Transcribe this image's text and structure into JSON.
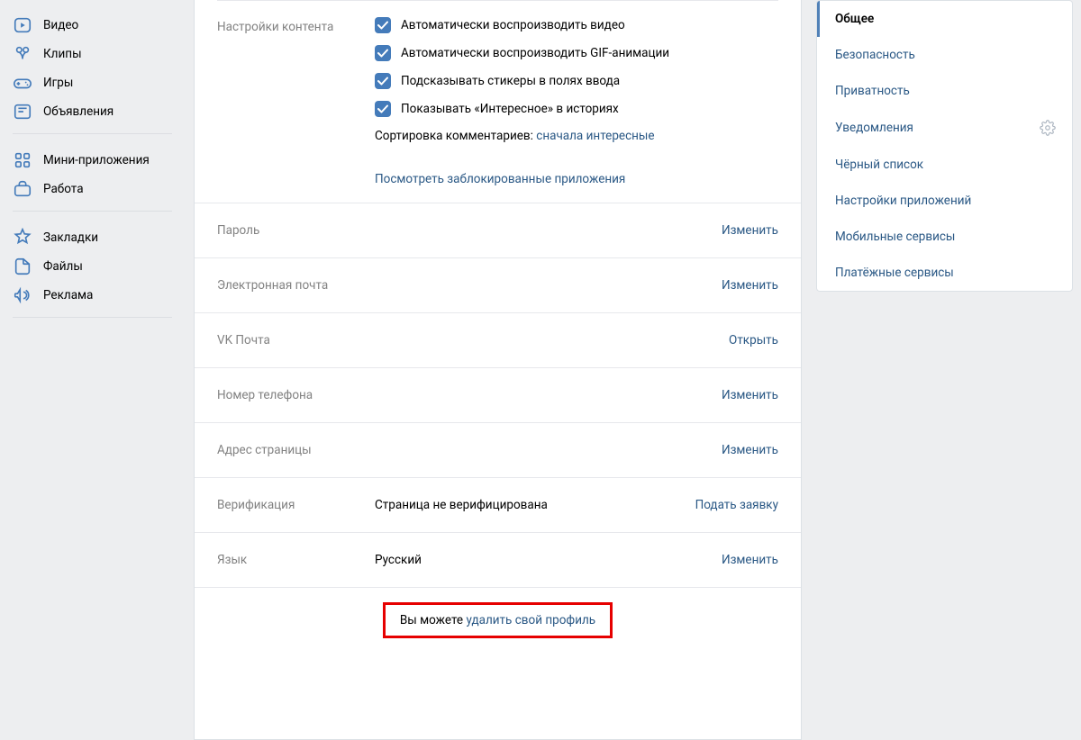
{
  "leftNav": {
    "group1": [
      {
        "icon": "video",
        "label": "Видео"
      },
      {
        "icon": "clips",
        "label": "Клипы"
      },
      {
        "icon": "games",
        "label": "Игры"
      },
      {
        "icon": "ads",
        "label": "Объявления"
      }
    ],
    "group2": [
      {
        "icon": "miniapps",
        "label": "Мини-приложения"
      },
      {
        "icon": "work",
        "label": "Работа"
      }
    ],
    "group3": [
      {
        "icon": "bookmarks",
        "label": "Закладки"
      },
      {
        "icon": "files",
        "label": "Файлы"
      },
      {
        "icon": "promo",
        "label": "Реклама"
      }
    ]
  },
  "content": {
    "sectionLabel": "Настройки контента",
    "checks": [
      "Автоматически воспроизводить видео",
      "Автоматически воспроизводить GIF-анимации",
      "Подсказывать стикеры в полях ввода",
      "Показывать «Интересное» в историях"
    ],
    "sortLabel": "Сортировка комментариев: ",
    "sortValue": "сначала интересные",
    "blockedLink": "Посмотреть заблокированные приложения"
  },
  "rows": {
    "password": {
      "label": "Пароль",
      "action": "Изменить"
    },
    "email": {
      "label": "Электронная почта",
      "action": "Изменить"
    },
    "vkmail": {
      "label": "VK Почта",
      "action": "Открыть"
    },
    "phone": {
      "label": "Номер телефона",
      "action": "Изменить"
    },
    "address": {
      "label": "Адрес страницы",
      "action": "Изменить"
    },
    "verification": {
      "label": "Верификация",
      "value": "Страница не верифицирована",
      "action": "Подать заявку"
    },
    "language": {
      "label": "Язык",
      "value": "Русский",
      "action": "Изменить"
    }
  },
  "footer": {
    "prefix": "Вы можете ",
    "link": "удалить свой профиль"
  },
  "rightNav": [
    {
      "label": "Общее",
      "active": true
    },
    {
      "label": "Безопасность"
    },
    {
      "label": "Приватность"
    },
    {
      "label": "Уведомления",
      "gear": true
    },
    {
      "label": "Чёрный список"
    },
    {
      "label": "Настройки приложений"
    },
    {
      "label": "Мобильные сервисы"
    },
    {
      "label": "Платёжные сервисы"
    }
  ]
}
